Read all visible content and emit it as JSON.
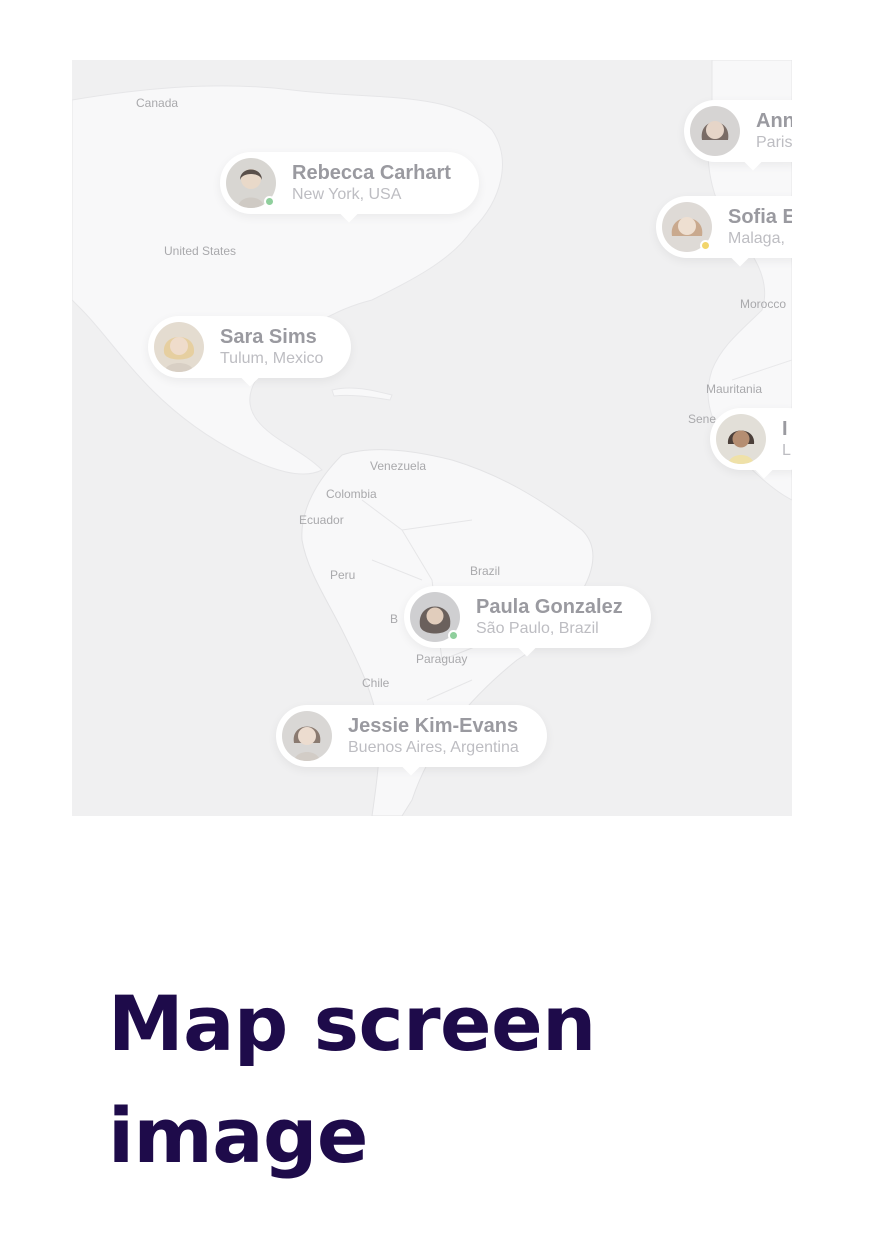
{
  "map": {
    "countries": [
      "Canada",
      "United States",
      "Venezuela",
      "Colombia",
      "Ecuador",
      "Peru",
      "Brazil",
      "Paraguay",
      "Chile",
      "Morocco",
      "Mauritania",
      "Sene",
      "B"
    ],
    "pins": [
      {
        "name": "Rebecca Carhart",
        "location": "New York, USA",
        "status": "online",
        "status_color": "#8fcf9c"
      },
      {
        "name": "Sara Sims",
        "location": "Tulum, Mexico",
        "status": "none"
      },
      {
        "name": "Paula Gonzalez",
        "location": "São Paulo, Brazil",
        "status": "online",
        "status_color": "#8fcf9c"
      },
      {
        "name": "Jessie Kim-Evans",
        "location": "Buenos Aires, Argentina",
        "status": "none"
      },
      {
        "name": "Ann",
        "location": "Paris",
        "status": "none"
      },
      {
        "name": "Sofia E",
        "location": "Malaga,",
        "status": "away",
        "status_color": "#f2d56b"
      },
      {
        "name": "I",
        "location": "L",
        "status": "none"
      }
    ]
  },
  "caption": "Map screen image",
  "colors": {
    "caption": "#1e0b4a",
    "map_bg": "#f0f0f1",
    "land": "#f7f7f8"
  }
}
